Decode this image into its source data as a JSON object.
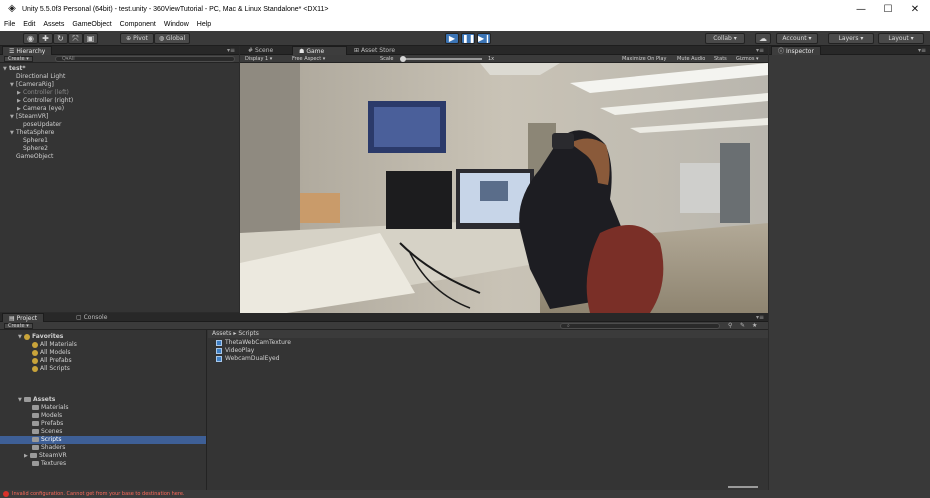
{
  "window": {
    "title": "Unity 5.5.0f3 Personal (64bit) - test.unity - 360ViewTutorial - PC, Mac & Linux Standalone* <DX11>",
    "minimize": "—",
    "maximize": "☐",
    "close": "✕"
  },
  "menu": [
    "File",
    "Edit",
    "Assets",
    "GameObject",
    "Component",
    "Window",
    "Help"
  ],
  "toolbar": {
    "pivot": "Pivot",
    "global": "Global",
    "collab": "Collab ▾",
    "account": "Account ▾",
    "layers": "Layers",
    "layout": "Layout"
  },
  "hierarchy": {
    "tab": "Hierarchy",
    "create": "Create ▾",
    "search_placeholder": "Q▾All",
    "items": [
      {
        "label": "test*",
        "level": 0,
        "arrow": "▼",
        "bold": true
      },
      {
        "label": "Directional Light",
        "level": 1,
        "arrow": ""
      },
      {
        "label": "[CameraRig]",
        "level": 1,
        "arrow": "▼"
      },
      {
        "label": "Controller (left)",
        "level": 2,
        "arrow": "▶",
        "dim": true
      },
      {
        "label": "Controller (right)",
        "level": 2,
        "arrow": "▶"
      },
      {
        "label": "Camera (eye)",
        "level": 2,
        "arrow": "▶"
      },
      {
        "label": "[SteamVR]",
        "level": 1,
        "arrow": "▼"
      },
      {
        "label": "poseUpdater",
        "level": 2,
        "arrow": ""
      },
      {
        "label": "ThetaSphere",
        "level": 1,
        "arrow": "▼"
      },
      {
        "label": "Sphere1",
        "level": 2,
        "arrow": ""
      },
      {
        "label": "Sphere2",
        "level": 2,
        "arrow": ""
      },
      {
        "label": "GameObject",
        "level": 1,
        "arrow": ""
      }
    ]
  },
  "scene_tabs": {
    "scene": "Scene",
    "game": "Game",
    "asset_store": "Asset Store"
  },
  "game_toolbar": {
    "display": "Display 1",
    "aspect": "Free Aspect",
    "scale_label": "Scale",
    "scale_value": "1x",
    "maximize": "Maximize On Play",
    "mute": "Mute Audio",
    "stats": "Stats",
    "gizmos": "Gizmos ▾"
  },
  "inspector": {
    "tab": "Inspector"
  },
  "project": {
    "tab_project": "Project",
    "tab_console": "Console",
    "create": "Create ▾",
    "favorites_label": "Favorites",
    "favorites": [
      "All Materials",
      "All Models",
      "All Prefabs",
      "All Scripts"
    ],
    "assets_label": "Assets",
    "folders": [
      {
        "label": "Materials",
        "arrow": ""
      },
      {
        "label": "Models",
        "arrow": ""
      },
      {
        "label": "Prefabs",
        "arrow": ""
      },
      {
        "label": "Scenes",
        "arrow": ""
      },
      {
        "label": "Scripts",
        "arrow": "",
        "selected": true
      },
      {
        "label": "Shaders",
        "arrow": ""
      },
      {
        "label": "SteamVR",
        "arrow": "▶"
      },
      {
        "label": "Textures",
        "arrow": ""
      }
    ],
    "breadcrumb": "Assets ▸ Scripts",
    "files": [
      "ThetaWebCamTexture",
      "VideoPlay",
      "WebcamDualEyed"
    ]
  },
  "status": {
    "message": "Invalid configuration. Cannot get from your base to destination here."
  },
  "colors": {
    "play_active": "#3b74b5",
    "selection": "#3e5f96",
    "error": "#d8312a"
  }
}
